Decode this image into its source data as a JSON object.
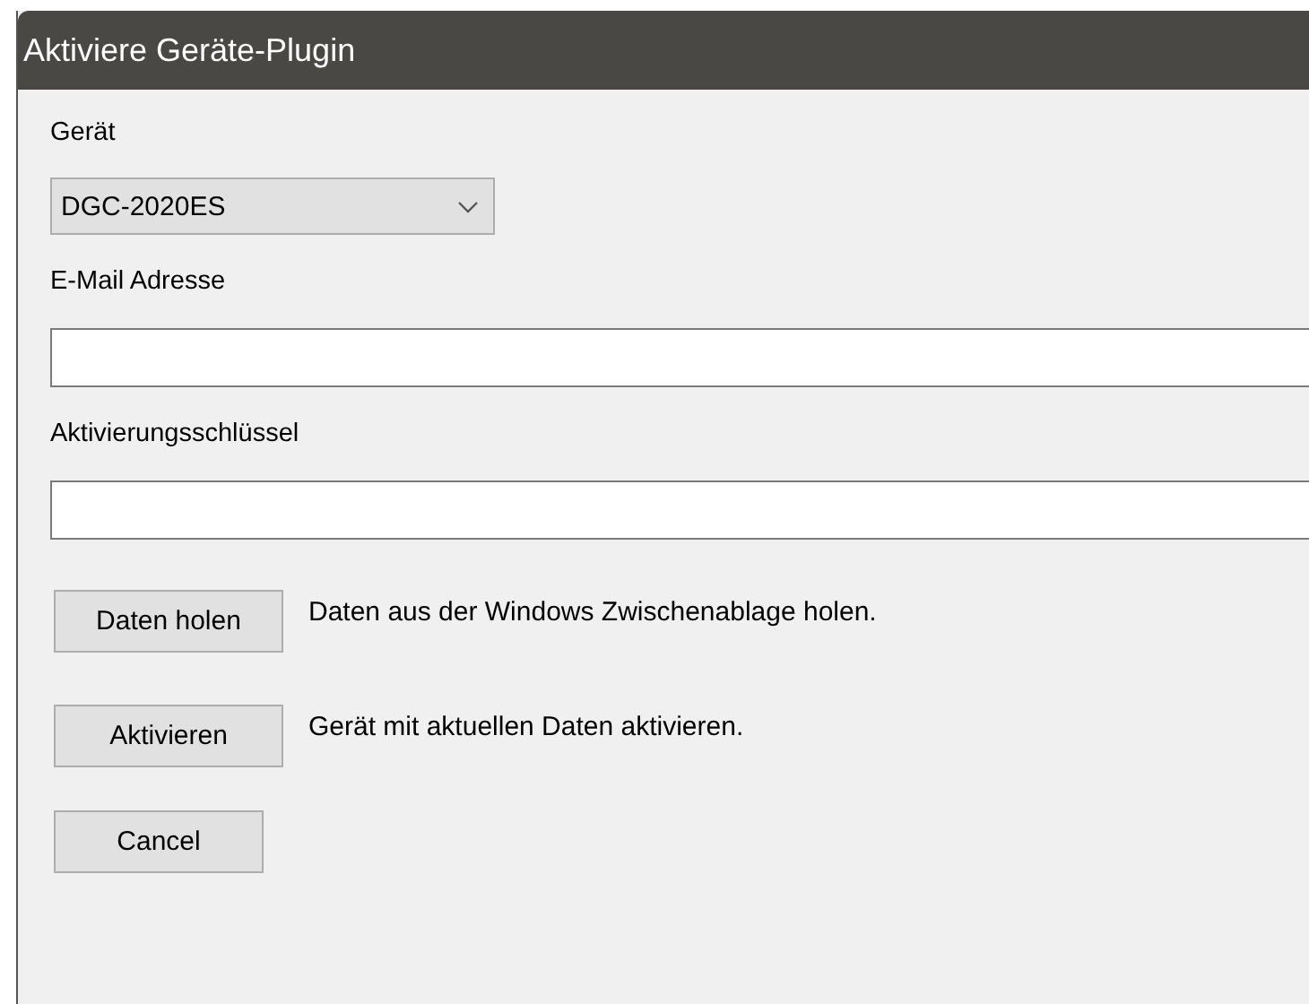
{
  "window": {
    "title": "Aktiviere Geräte-Plugin"
  },
  "device": {
    "label": "Gerät",
    "value": "DGC-2020ES"
  },
  "email": {
    "label": "E-Mail Adresse"
  },
  "key": {
    "label": "Aktivierungsschlüssel"
  },
  "actions": [
    {
      "button": "Daten holen",
      "description": "Daten aus der Windows Zwischenablage holen."
    },
    {
      "button": "Aktivieren",
      "description": "Gerät mit aktuellen Daten aktivieren."
    }
  ],
  "cancel": "Cancel"
}
